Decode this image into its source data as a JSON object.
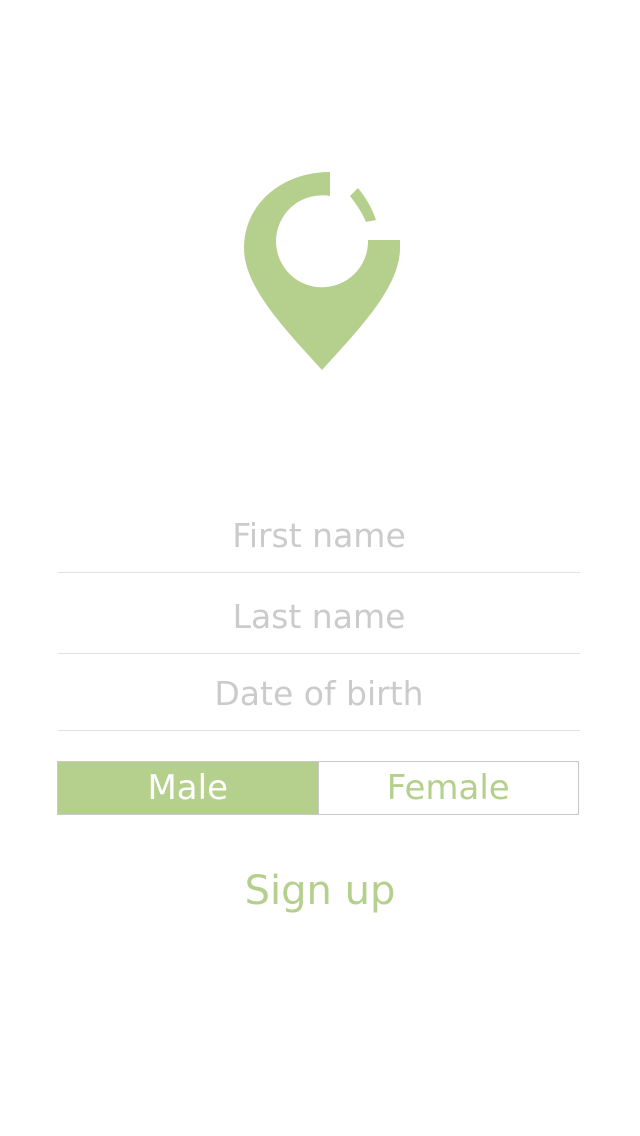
{
  "logo": {
    "icon": "location-pin-icon",
    "color": "#b5cf8c"
  },
  "form": {
    "first_name": {
      "placeholder": "First name",
      "value": ""
    },
    "last_name": {
      "placeholder": "Last name",
      "value": ""
    },
    "date_of_birth": {
      "placeholder": "Date of birth",
      "value": ""
    }
  },
  "gender": {
    "options": [
      "Male",
      "Female"
    ],
    "selected": "Male",
    "accent": "#b5cf8c"
  },
  "actions": {
    "signup_label": "Sign up"
  }
}
